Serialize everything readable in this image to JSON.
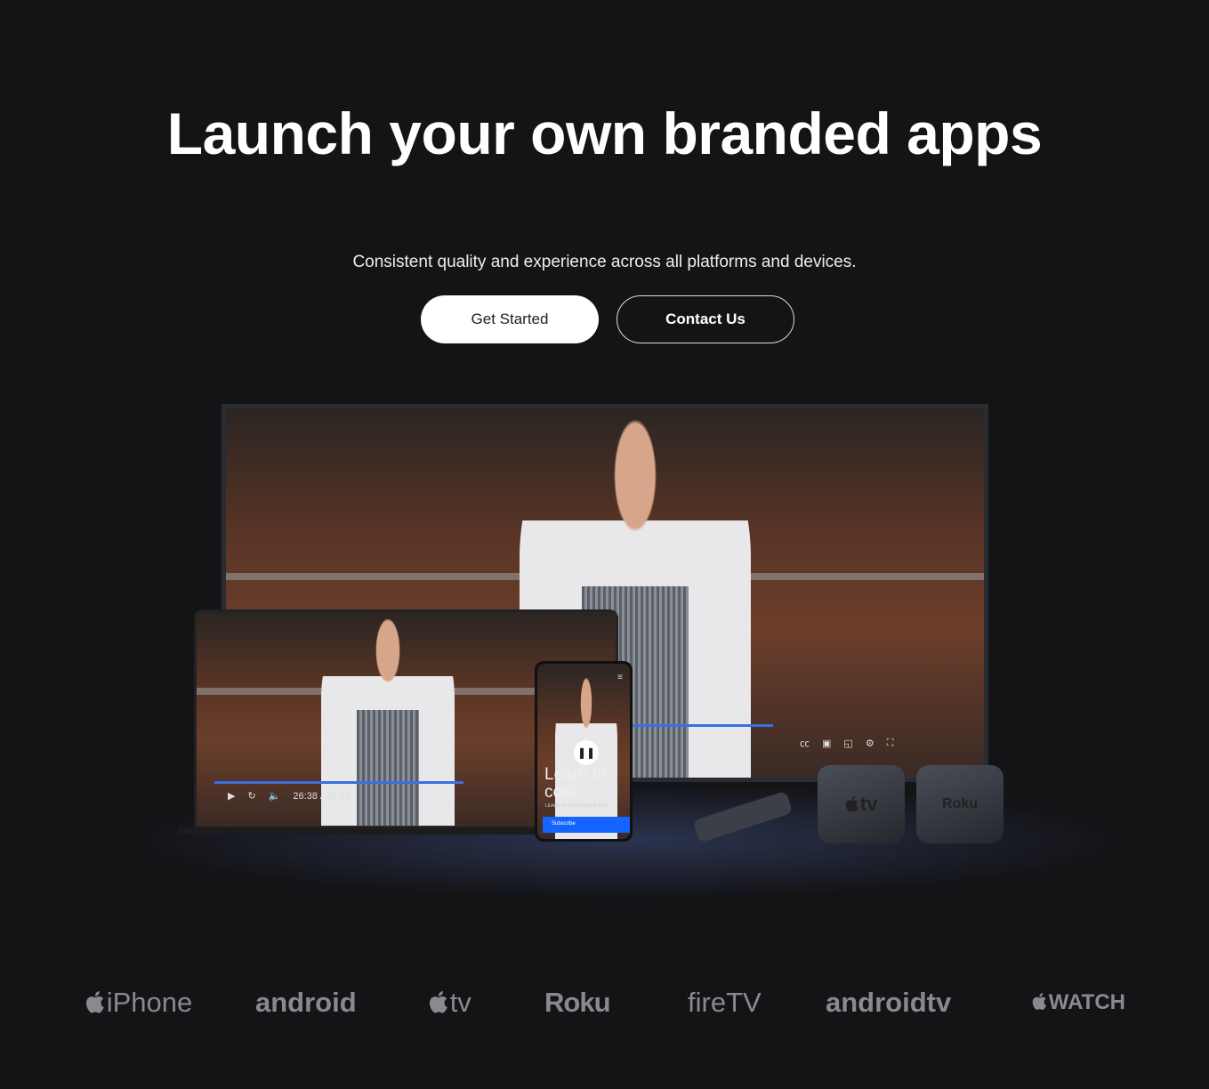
{
  "hero": {
    "title": "Launch your own branded apps",
    "subtitle": "Consistent quality and experience across all platforms and devices.",
    "get_started": "Get Started",
    "contact_us": "Contact Us"
  },
  "media": {
    "laptop_time": "26:38 / 30:23",
    "phone": {
      "headline": "Learn to cook.",
      "tagline": "LEARN TO COOK LIKE A PRO",
      "button": "Subscribe"
    },
    "devices": {
      "apple_tv": "tv",
      "roku": "Roku"
    },
    "accent": "#3a6fe0"
  },
  "platforms": [
    {
      "label": "iPhone",
      "icon": "apple-icon"
    },
    {
      "label": "android"
    },
    {
      "label": "tv",
      "icon": "apple-icon"
    },
    {
      "label": "Roku"
    },
    {
      "label": "fireTV"
    },
    {
      "label": "androidtv"
    },
    {
      "label": "WATCH",
      "icon": "apple-icon"
    }
  ]
}
